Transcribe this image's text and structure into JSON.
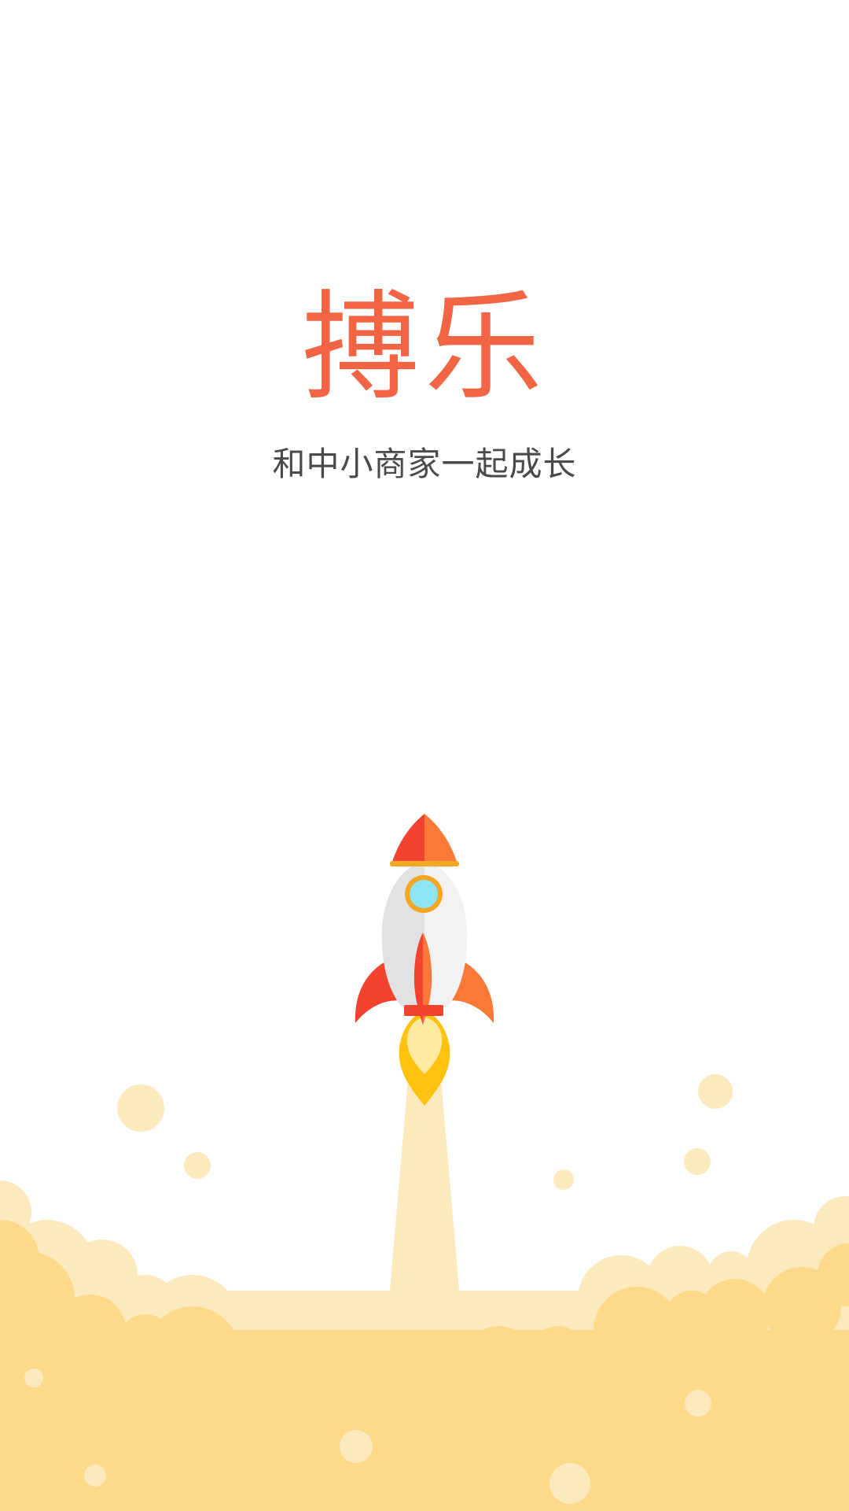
{
  "splash": {
    "app_name": "搏乐",
    "tagline": "和中小商家一起成长"
  },
  "colors": {
    "brand": "#F26544",
    "tagline_text": "#4A4A4A",
    "background": "#FFFFFF",
    "cloud_light": "#FDE9BE",
    "cloud_dark": "#FDD98A",
    "rocket_red": "#F2432E",
    "rocket_orange": "#FB7938",
    "rocket_body_left": "#E2E2E4",
    "rocket_body_right": "#F2F2F2",
    "window_glass": "#8CE4F5",
    "window_ring": "#F5A623",
    "flame_outer": "#FFC20E",
    "flame_inner": "#FFE8A0"
  },
  "illustration": {
    "icon": "rocket-launch-icon"
  }
}
